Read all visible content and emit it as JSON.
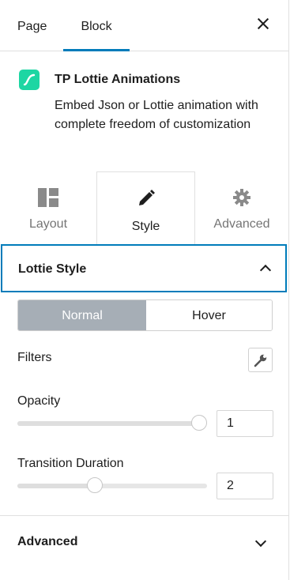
{
  "top_tabs": {
    "page": "Page",
    "block": "Block"
  },
  "block": {
    "title": "TP Lottie Animations",
    "description": "Embed Json or Lottie animation with complete freedom of customization",
    "icon_color": "#1dd6a3"
  },
  "inner_tabs": {
    "layout": "Layout",
    "style": "Style",
    "advanced": "Advanced"
  },
  "section": {
    "title": "Lottie Style"
  },
  "state_toggle": {
    "normal": "Normal",
    "hover": "Hover",
    "active": "Normal"
  },
  "filters": {
    "label": "Filters"
  },
  "opacity": {
    "label": "Opacity",
    "value": "1",
    "fraction": 1.0
  },
  "transition": {
    "label": "Transition Duration",
    "value": "2",
    "fraction": 0.4
  },
  "advanced_section": {
    "title": "Advanced"
  },
  "colors": {
    "accent": "#007cba",
    "toggle_active": "#a6aeb6"
  }
}
